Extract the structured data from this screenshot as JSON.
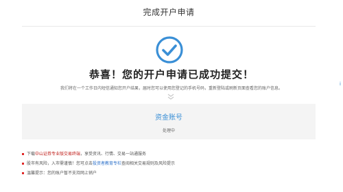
{
  "header": {
    "title": "完成开户申请"
  },
  "result": {
    "icon": "checkmark-circle-icon",
    "icon_color": "#3a8fd6",
    "headline": "恭喜！您的开户申请已成功提交！",
    "description": "我们将在一个工作日内短信通知您开户结果，届时您可以使用您登记的手机号码，重新登陆或刷新页面查看您的账户信息。"
  },
  "account": {
    "label": "资金账号",
    "status": "处理中",
    "label_color": "#3a8fd6"
  },
  "notes": [
    {
      "parts": [
        {
          "text": "下载",
          "style": "plain"
        },
        {
          "text": "中山证券专业版交易终端",
          "style": "red"
        },
        {
          "text": "，享受资讯、行情、交易一站通服务",
          "style": "plain"
        }
      ]
    },
    {
      "parts": [
        {
          "text": "股市有风险，入市需谨慎！您可点击",
          "style": "plain"
        },
        {
          "text": "投资者教育专栏",
          "style": "blue"
        },
        {
          "text": "查阅相关交易规则及风险提示",
          "style": "plain"
        }
      ]
    },
    {
      "parts": [
        {
          "text": "温馨提示：您的账户暂不支持网上销户",
          "style": "plain"
        }
      ]
    }
  ],
  "bullet_color": "#e02828",
  "edge_mark": "i"
}
